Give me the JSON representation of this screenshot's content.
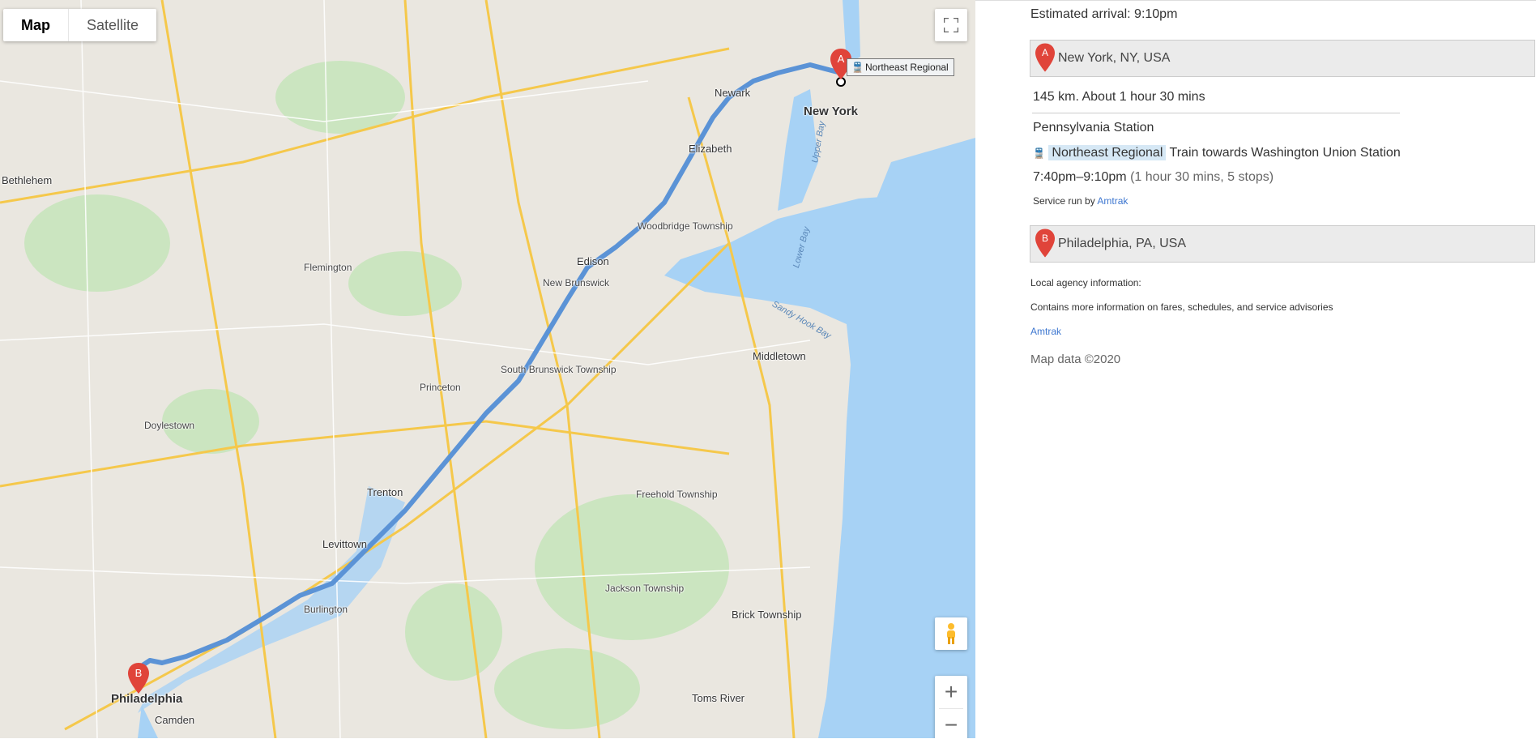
{
  "map": {
    "type_control": {
      "map_label": "Map",
      "satellite_label": "Satellite"
    },
    "marker_a_label": "A",
    "marker_b_label": "B",
    "transit_chip_label": "Northeast Regional",
    "zoom_in": "+",
    "zoom_out": "−",
    "labels": {
      "cities": [
        "New York",
        "Newark",
        "Philadelphia",
        "Trenton",
        "Edison",
        "Elizabeth",
        "Levittown",
        "Camden",
        "Bethlehem"
      ],
      "towns": [
        "Woodbridge Township",
        "New Brunswick",
        "South Brunswick Township",
        "Middletown",
        "Toms River",
        "Brick Township",
        "Princeton",
        "Flemington",
        "Doylestown",
        "Burlington",
        "Freehold Township",
        "Jackson Township"
      ],
      "water": [
        "Upper Bay",
        "Lower Bay",
        "Sandy Hook Bay"
      ]
    },
    "colors": {
      "route": "#5b93d6",
      "water": "#a7d2f5",
      "land": "#eae7e0",
      "park": "#cbe5c0",
      "marker": "#e0443a"
    }
  },
  "panel": {
    "estimated_arrival": "Estimated arrival: 9:10pm",
    "origin": "New York, NY, USA",
    "distance_time": "145 km. About 1 hour 30 mins",
    "station": "Pennsylvania Station",
    "line_name": "Northeast Regional",
    "line_direction": "Train towards Washington Union Station",
    "time_range": "7:40pm–9:10pm",
    "duration_stops": "(1 hour 30 mins, 5 stops)",
    "service_run_by": "Service run by",
    "operator": "Amtrak",
    "destination": "Philadelphia, PA, USA",
    "local_agency_heading": "Local agency information:",
    "local_agency_desc": "Contains more information on fares, schedules, and service advisories",
    "agency_link": "Amtrak",
    "map_data": "Map data ©2020"
  }
}
